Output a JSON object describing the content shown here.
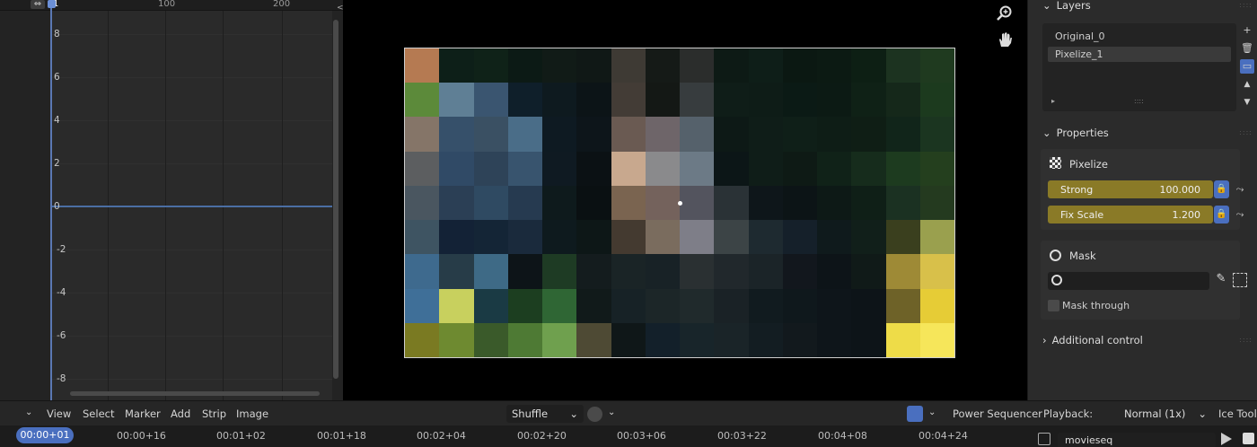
{
  "graph": {
    "ruler_marks": [
      "1",
      "100",
      "200"
    ],
    "y_labels": [
      "8",
      "6",
      "4",
      "2",
      "0",
      "-2",
      "-4",
      "-6",
      "-8"
    ]
  },
  "sidebar": {
    "layers_title": "Layers",
    "layers": [
      "Original_0",
      "Pixelize_1"
    ],
    "selected_layer": "Pixelize_1",
    "properties_title": "Properties",
    "effect_name": "Pixelize",
    "strong_label": "Strong",
    "strong_value": "100.000",
    "fix_scale_label": "Fix Scale",
    "fix_scale_value": "1.200",
    "mask_title": "Mask",
    "mask_through_label": "Mask through",
    "additional_title": "Additional control"
  },
  "header": {
    "menus": [
      "View",
      "Select",
      "Marker",
      "Add",
      "Strip",
      "Image"
    ],
    "shuffle_label": "Shuffle",
    "power_sequencer": "Power Sequencer",
    "playback_label": "Playback:",
    "playback_value": "Normal (1x)",
    "ice_tools": "Ice Tools"
  },
  "timeline": {
    "current": "00:00+01",
    "marks": [
      "00:00+16",
      "00:01+02",
      "00:01+18",
      "00:02+04",
      "00:02+20",
      "00:03+06",
      "00:03+22",
      "00:04+08",
      "00:04+24"
    ],
    "strip_name": "movieseq"
  },
  "colors": {
    "accent_blue": "#4a6fbf",
    "slider_gold": "#8a7a27"
  }
}
